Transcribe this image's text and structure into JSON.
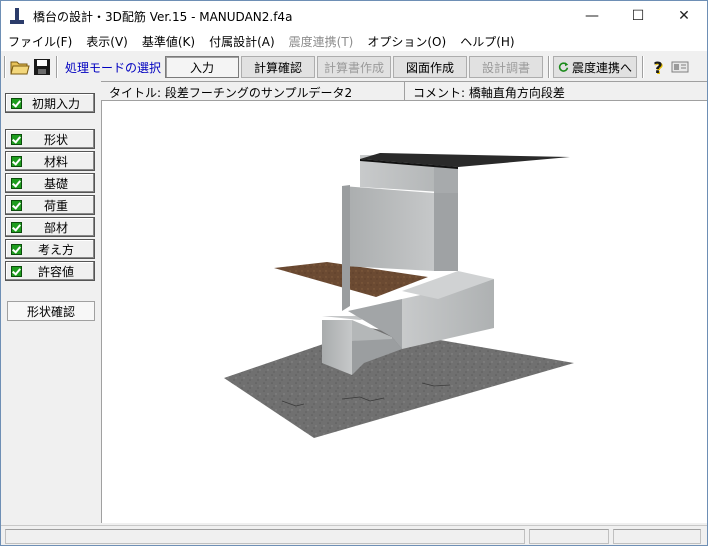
{
  "window": {
    "title": "橋台の設計・3D配筋 Ver.15 - MANUDAN2.f4a",
    "minimize_glyph": "—",
    "maximize_glyph": "☐",
    "close_glyph": "✕"
  },
  "menu": [
    {
      "label": "ファイル(F)",
      "enabled": true
    },
    {
      "label": "表示(V)",
      "enabled": true
    },
    {
      "label": "基準値(K)",
      "enabled": true
    },
    {
      "label": "付属設計(A)",
      "enabled": true
    },
    {
      "label": "震度連携(T)",
      "enabled": false
    },
    {
      "label": "オプション(O)",
      "enabled": true
    },
    {
      "label": "ヘルプ(H)",
      "enabled": true
    }
  ],
  "toolbar": {
    "mode_label": "処理モードの選択",
    "buttons": [
      {
        "label": "入力",
        "state": "pressed"
      },
      {
        "label": "計算確認",
        "state": "normal"
      },
      {
        "label": "計算書作成",
        "state": "disabled"
      },
      {
        "label": "図面作成",
        "state": "normal"
      },
      {
        "label": "設計調書",
        "state": "disabled"
      }
    ],
    "seismic_button": "震度連携へ",
    "help_glyph": "?"
  },
  "sidebar": {
    "initial_input": "初期入力",
    "items": [
      "形状",
      "材料",
      "基礎",
      "荷重",
      "部材",
      "考え方",
      "許容値"
    ],
    "shape_check": "形状確認"
  },
  "info": {
    "title": "タイトル: 段差フーチングのサンプルデータ2",
    "comment": "コメント: 橋軸直角方向段差"
  },
  "colors": {
    "mode_label": "#0000c0",
    "check_green": "#1e9c1e",
    "concrete": "#b9bcbd",
    "ground": "#6f6f6f",
    "soil": "#6b4a32"
  }
}
